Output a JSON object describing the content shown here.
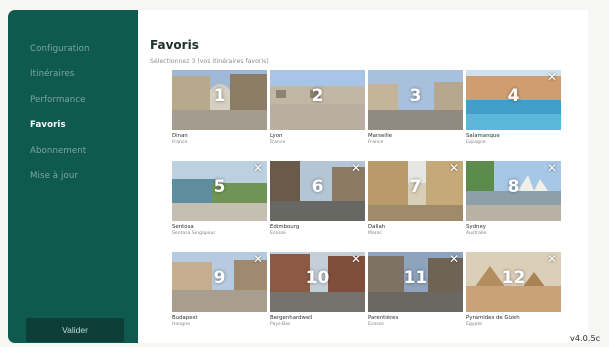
{
  "sidebar": {
    "nav": [
      {
        "label": "Configuration",
        "active": false
      },
      {
        "label": "Itinéraires",
        "active": false
      },
      {
        "label": "Performance",
        "active": false
      },
      {
        "label": "Favoris",
        "active": true
      },
      {
        "label": "Abonnement",
        "active": false
      },
      {
        "label": "Mise à jour",
        "active": false
      }
    ],
    "submit_label": "Valider"
  },
  "main": {
    "title": "Favoris",
    "subtitle": "Sélectionnez 3 (vos itinéraires favoris)",
    "close_glyph": "✕",
    "routes": [
      {
        "number": "1",
        "name": "Dinan",
        "country": "France",
        "removable": false,
        "scene": "street-arch"
      },
      {
        "number": "2",
        "name": "Lyon",
        "country": "France",
        "removable": false,
        "scene": "plaza"
      },
      {
        "number": "3",
        "name": "Marseille",
        "country": "France",
        "removable": false,
        "scene": "harbor-street"
      },
      {
        "number": "4",
        "name": "Salamanque",
        "country": "Espagne",
        "removable": true,
        "scene": "pool-building"
      },
      {
        "number": "5",
        "name": "Sentosa",
        "country": "Sentosa Singapour",
        "removable": true,
        "scene": "coast-path"
      },
      {
        "number": "6",
        "name": "Edimbourg",
        "country": "Ecosse",
        "removable": true,
        "scene": "city-road"
      },
      {
        "number": "7",
        "name": "Dallah",
        "country": "Maroc",
        "removable": true,
        "scene": "alley"
      },
      {
        "number": "8",
        "name": "Sydney",
        "country": "Australie",
        "removable": true,
        "scene": "opera"
      },
      {
        "number": "9",
        "name": "Budapest",
        "country": "Hongrie",
        "removable": true,
        "scene": "square"
      },
      {
        "number": "10",
        "name": "Bergenhardwell",
        "country": "Pays-Bas",
        "removable": true,
        "scene": "brick-street"
      },
      {
        "number": "11",
        "name": "Parentières",
        "country": "Ecosse",
        "removable": true,
        "scene": "street-dusk"
      },
      {
        "number": "12",
        "name": "Pyramides de Gizeh",
        "country": "Egypte",
        "removable": true,
        "scene": "desert"
      }
    ]
  },
  "version": "v4.0.5c",
  "colors": {
    "sidebar": "#0f5a4f",
    "nav_inactive": "#7fa59d",
    "nav_active": "#ffffff",
    "button": "#0b3f38",
    "background": "#f6f6f5"
  }
}
